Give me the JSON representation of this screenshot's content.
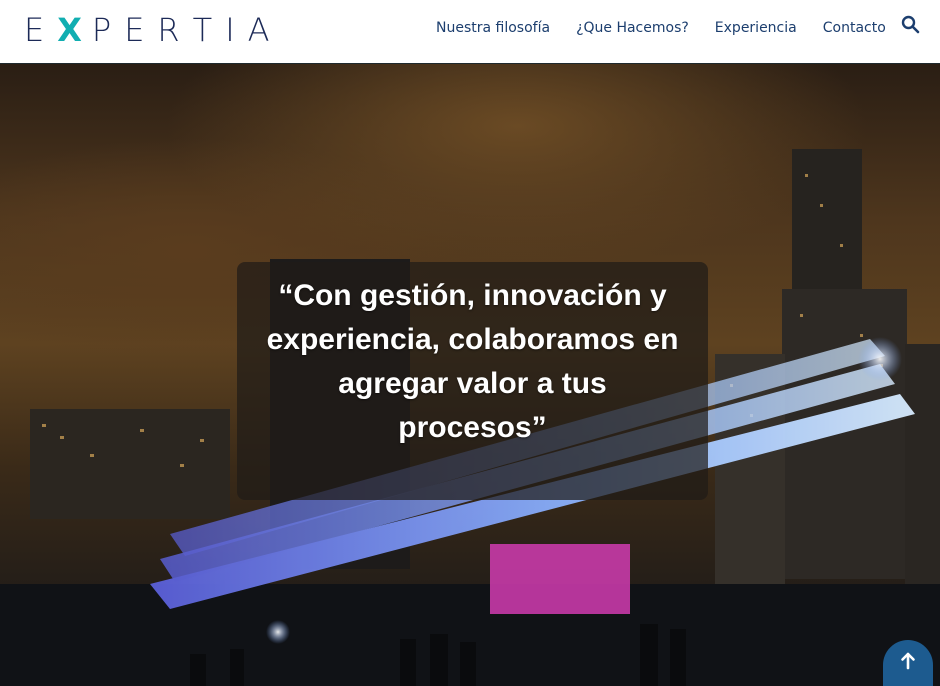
{
  "brand": {
    "letters": [
      "E",
      "X",
      "P",
      "E",
      "R",
      "T",
      "I",
      "A"
    ],
    "accent_letter_index": 1,
    "colors": {
      "primary": "#1c2a57",
      "accent": "#11aeb1"
    }
  },
  "nav": {
    "items": [
      {
        "label": "Nuestra filosofía"
      },
      {
        "label": "¿Que Hacemos?"
      },
      {
        "label": "Experiencia"
      },
      {
        "label": "Contacto"
      }
    ],
    "search_icon": "search-icon",
    "color": "#1c3e6e"
  },
  "hero": {
    "quote": "“Con gestión, innovación y experiencia, colaboramos en agregar valor a tus procesos”",
    "background_description_icon": "night-city-art-installation"
  },
  "back_to_top": {
    "icon": "arrow-up-icon",
    "color": "#1d5b8f"
  }
}
